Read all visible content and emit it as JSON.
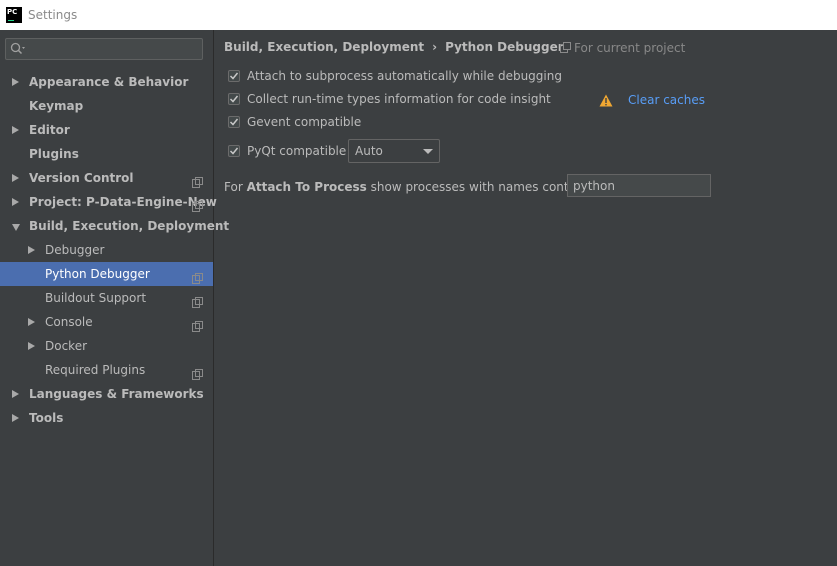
{
  "window": {
    "title": "Settings",
    "logo_text": "PC"
  },
  "sidebar": {
    "search": {
      "value": "",
      "placeholder": ""
    },
    "items": [
      {
        "label": "Appearance & Behavior",
        "expander": "collapsed",
        "bold": true,
        "level": 0,
        "project": false
      },
      {
        "label": "Keymap",
        "expander": "none",
        "bold": true,
        "level": 0,
        "project": false
      },
      {
        "label": "Editor",
        "expander": "collapsed",
        "bold": true,
        "level": 0,
        "project": false
      },
      {
        "label": "Plugins",
        "expander": "none",
        "bold": true,
        "level": 0,
        "project": false
      },
      {
        "label": "Version Control",
        "expander": "collapsed",
        "bold": true,
        "level": 0,
        "project": true
      },
      {
        "label": "Project: P-Data-Engine-New",
        "expander": "collapsed",
        "bold": true,
        "level": 0,
        "project": true
      },
      {
        "label": "Build, Execution, Deployment",
        "expander": "expanded",
        "bold": true,
        "level": 0,
        "project": false
      },
      {
        "label": "Debugger",
        "expander": "collapsed",
        "bold": false,
        "level": 1,
        "project": false
      },
      {
        "label": "Python Debugger",
        "expander": "none",
        "bold": false,
        "level": 1,
        "project": true,
        "selected": true
      },
      {
        "label": "Buildout Support",
        "expander": "none",
        "bold": false,
        "level": 1,
        "project": true
      },
      {
        "label": "Console",
        "expander": "collapsed",
        "bold": false,
        "level": 1,
        "project": true
      },
      {
        "label": "Docker",
        "expander": "collapsed",
        "bold": false,
        "level": 1,
        "project": false
      },
      {
        "label": "Required Plugins",
        "expander": "none",
        "bold": false,
        "level": 1,
        "project": true
      },
      {
        "label": "Languages & Frameworks",
        "expander": "collapsed",
        "bold": true,
        "level": 0,
        "project": false
      },
      {
        "label": "Tools",
        "expander": "collapsed",
        "bold": true,
        "level": 0,
        "project": false
      }
    ]
  },
  "content": {
    "breadcrumb": {
      "parent": "Build, Execution, Deployment",
      "separator": "›",
      "current": "Python Debugger"
    },
    "scope_label": "For current project",
    "options": {
      "attach_subprocess": {
        "label": "Attach to subprocess automatically while debugging",
        "checked": true
      },
      "collect_types": {
        "label": "Collect run-time types information for code insight",
        "checked": true
      },
      "gevent": {
        "label": "Gevent compatible",
        "checked": true
      },
      "pyqt": {
        "label": "PyQt compatible",
        "checked": true,
        "selected_option": "Auto"
      }
    },
    "clear_caches_label": "Clear caches",
    "attach_process": {
      "prefix": "For",
      "bold": "Attach To Process",
      "suffix": "show processes with names containing:",
      "value": "python"
    }
  },
  "colors": {
    "background": "#3c3f41",
    "selection": "#4b6eaf",
    "link": "#589df6",
    "warning": "#f0a732",
    "text": "#bbbbbb"
  },
  "icons": {
    "search": "search-icon",
    "project_scope": "project-scope-icon",
    "warning": "warning-icon",
    "checkmark": "checkmark-icon"
  }
}
